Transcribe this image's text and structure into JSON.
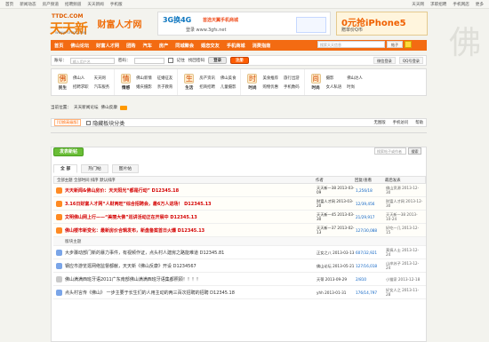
{
  "topbar": {
    "left": [
      "首页",
      "新闻动态",
      "房产频道",
      "招聘频道",
      "天天新闻",
      "手机版"
    ],
    "right": [
      "天天网",
      "求职招聘",
      "手机网店",
      "更多"
    ]
  },
  "header": {
    "logo_top": "TTDC.COM",
    "logo_main": "天天新",
    "logo_sub": "WWW.FSFCDC.COM",
    "brand": "财富人才网",
    "banner": {
      "line1": "3G换4G",
      "line2": "首选天翼手机商城",
      "line3": "登录 www.3gfs.net"
    },
    "promo": {
      "line1": "0元抢iPhone5",
      "line2": "赠单价Q币"
    }
  },
  "nav": {
    "items": [
      "首页",
      "佛山论坛",
      "财富人才网",
      "团购",
      "汽车",
      "房产",
      "同城聚会",
      "婚恋交友",
      "手机商城",
      "消费指南"
    ],
    "search_placeholder": "搜索天天信息",
    "search_option": "帖子"
  },
  "login": {
    "username_label": "账号：",
    "username_placeholder": "输入用户名",
    "password_label": "密码：",
    "remember": "记住",
    "find_password": "找回密码",
    "login_button": "登录",
    "register_button": "注册",
    "right_links": [
      "微信登录",
      "QQ号登录"
    ]
  },
  "services": [
    {
      "title": "民生",
      "icon": "佛",
      "links": [
        "佛山人",
        "天天网",
        "招聘求职",
        "汽车服务"
      ]
    },
    {
      "title": "情感",
      "icon": "情",
      "links": [
        "佛山新情",
        "征婚征友",
        "婚庆摄影",
        "亲子教育"
      ]
    },
    {
      "title": "生活",
      "icon": "生",
      "links": [
        "房产资讯",
        "佛山美食",
        "招商招聘",
        "儿童摄影"
      ]
    },
    {
      "title": "时尚",
      "icon": "时",
      "links": [
        "美食推荐",
        "旅行出游",
        "购物优惠",
        "手机数码"
      ]
    },
    {
      "title": "时尚",
      "icon": "尚",
      "links": [
        "摄影",
        "佛山达人",
        "女人私语",
        "时尚"
      ]
    }
  ],
  "breadcrumb": [
    "当前位置：",
    "天天新闻论坛",
    "佛山反康"
  ],
  "forumtools": {
    "tag": "[切换高级版]",
    "checkbox": "隐藏板块分类",
    "right": [
      "无图版",
      "手机访问",
      "帮助"
    ]
  },
  "main": {
    "post_button": "发表新帖",
    "search_placeholder": "搜索帖子或作者",
    "search_button": "搜索",
    "tabs": [
      "全 部",
      "热门帖",
      "图片帖"
    ]
  },
  "table": {
    "head": {
      "topic": "全部主题 全部时间 排序 默认排序",
      "author": "作者",
      "replies": "回复/查看",
      "last": "最后发表"
    },
    "rows": [
      {
        "title": "天天新闻&佛山房价：天天阳光“都是行动” D12345.18",
        "author": "天天新一38\n2013-03-09",
        "count": "1,256/18",
        "last": "佛山资源\n2013-12-30",
        "hot": true
      },
      {
        "title": "3.16日财富人才网“人财两旺”综合招聘会，最6万人进场！ D12345.13",
        "author": "财富人才网\n2013-03-20",
        "count": "12/39,456",
        "last": "财富人才网\n2013-12-30",
        "hot": true
      },
      {
        "title": "文明佛山网上行——“美丽大佛”巡讲活动正在开展中 D12345.13",
        "author": "天天新一45\n2013-03-30",
        "count": "21/29,917",
        "last": "天天新一38\n2013-10-24",
        "hot": true
      },
      {
        "title": "佛山楼市新变化：最新房价合辑发布，新盘备案首日火爆 D12345.13",
        "author": "天天新一37\n2013-02-13",
        "count": "127/30,088",
        "last": "好吃一几\n2013-12-15",
        "hot": true
      },
      {
        "title": "大步骤动部门新的暴力事件，有视频作证，点头村人建房之路能难道 D12345.81",
        "author": "正女之八\n2013-03-13",
        "count": "607/32,921",
        "last": "莫搞人士\n2013-12-24",
        "hot": false
      },
      {
        "title": "钢应市游览逛网络监督都献，天天新《佛山反康》开设 D1234567",
        "author": "佛山论坛\n2013-05-21",
        "count": "127/16,018",
        "last": "山岸苏子\n2013-12-24",
        "hot": false
      },
      {
        "title": "佛山满满西班牙语2011广东南部佛山满满西班牙语集都照顾！！！！",
        "author": "天蒂\n2013-09-29",
        "count": "2/810",
        "last": "小猫家\n2013-12-18",
        "hot": false
      },
      {
        "title": "点头村言传《佛山》 一步主要于长生们的人用主动的两三百次招聘的招聘 D12345.18",
        "author": "yhh\n2013-01-31",
        "count": "176/14,797",
        "last": "好女人之\n2013-11-28",
        "hot": false
      }
    ]
  }
}
